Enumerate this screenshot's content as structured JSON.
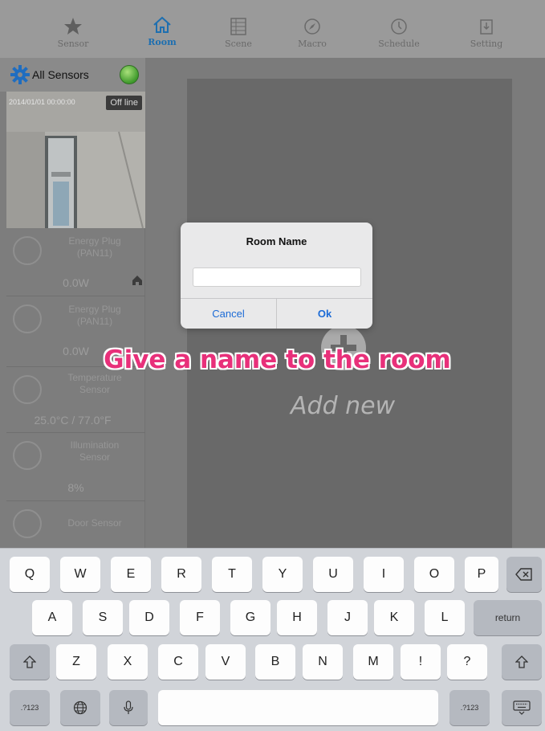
{
  "tabbar": {
    "tabs": [
      {
        "label": "Sensor",
        "icon": "star-icon"
      },
      {
        "label": "Room",
        "icon": "house-icon",
        "active": true
      },
      {
        "label": "Scene",
        "icon": "scene-grid-icon"
      },
      {
        "label": "Macro",
        "icon": "compass-icon"
      },
      {
        "label": "Schedule",
        "icon": "clock-icon"
      },
      {
        "label": "Setting",
        "icon": "settings-doc-icon"
      }
    ],
    "active_color": "#1e6fb0"
  },
  "sidebar": {
    "header_label": "All Sensors",
    "camera": {
      "badge": "Off line",
      "timestamp": "2014/01/01 00:00:00"
    },
    "sensors": [
      {
        "name": "Energy Plug\n(PAN11)",
        "value": "0.0W",
        "icon": "plug-icon"
      },
      {
        "name": "Energy Plug\n(PAN11)",
        "value": "0.0W",
        "icon": "plug-icon"
      },
      {
        "name": "Temperature\nSensor",
        "value": "25.0°C / 77.0°F",
        "icon": "thermometer-icon"
      },
      {
        "name": "Illumination\nSensor",
        "value": "8%",
        "icon": "bulb-icon"
      },
      {
        "name": "Door Sensor",
        "value": "",
        "icon": "door-icon"
      }
    ]
  },
  "main": {
    "add_label": "Add new",
    "annotation": "Give a name to the room"
  },
  "dialog": {
    "title": "Room Name",
    "input_value": "",
    "cancel_label": "Cancel",
    "ok_label": "Ok"
  },
  "keyboard": {
    "row1": [
      "Q",
      "W",
      "E",
      "R",
      "T",
      "Y",
      "U",
      "I",
      "O",
      "P"
    ],
    "row2": [
      "A",
      "S",
      "D",
      "F",
      "G",
      "H",
      "J",
      "K",
      "L"
    ],
    "row3": [
      "Z",
      "X",
      "C",
      "V",
      "B",
      "N",
      "M",
      "!",
      "?"
    ],
    "return_label": "return",
    "numbers_label": ".?123"
  }
}
